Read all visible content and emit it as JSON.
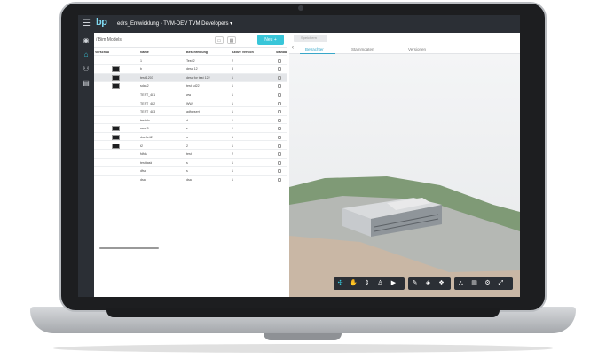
{
  "app": {
    "logo": "bp",
    "breadcrumb": "edrs_Entwicklung › TVM-DEV TVM Developers ▾"
  },
  "nav": {
    "menu_icon": "menu-icon",
    "items": [
      "eye-icon",
      "home-icon",
      "users-icon",
      "book-icon"
    ]
  },
  "list": {
    "title": "/ Bim Models",
    "new_button": "Neu",
    "columns": [
      "Vorschau",
      "Name",
      "Beschreibung",
      "Aktive Version",
      "Standa"
    ],
    "rows": [
      {
        "name": "1",
        "desc": "Test 2",
        "version": "2",
        "thumb": false,
        "selected": false
      },
      {
        "name": "b",
        "desc": "desc 12",
        "version": "3",
        "thumb": true,
        "selected": false
      },
      {
        "name": "test 1203",
        "desc": "desc for test 122",
        "version": "1",
        "thumb": true,
        "selected": true
      },
      {
        "name": "sdas2",
        "desc": "test sd22",
        "version": "1",
        "thumb": true,
        "selected": false
      },
      {
        "name": "TEST_4L1",
        "desc": "ww",
        "version": "1",
        "thumb": false,
        "selected": false
      },
      {
        "name": "TEST_4L2",
        "desc": "WW",
        "version": "1",
        "thumb": false,
        "selected": false
      },
      {
        "name": "TEST_4L3",
        "desc": "adfgvsert",
        "version": "1",
        "thumb": false,
        "selected": false
      },
      {
        "name": "test do",
        "desc": "d",
        "version": "1",
        "thumb": false,
        "selected": false
      },
      {
        "name": "new 5",
        "desc": "s",
        "version": "1",
        "thumb": true,
        "selected": false
      },
      {
        "name": "dse fe42",
        "desc": "s",
        "version": "1",
        "thumb": true,
        "selected": false
      },
      {
        "name": "t2",
        "desc": "2",
        "version": "1",
        "thumb": true,
        "selected": false
      },
      {
        "name": "fdfds",
        "desc": "test",
        "version": "2",
        "thumb": false,
        "selected": false
      },
      {
        "name": "test task",
        "desc": "s",
        "version": "1",
        "thumb": false,
        "selected": false
      },
      {
        "name": "dfsa",
        "desc": "s",
        "version": "1",
        "thumb": false,
        "selected": false
      },
      {
        "name": "dsa",
        "desc": "dsa",
        "version": "1",
        "thumb": false,
        "selected": false
      }
    ]
  },
  "viewer": {
    "save_button": "Speichern",
    "tabs": [
      "Betrachter",
      "Stammdaten",
      "Versionen"
    ],
    "active_tab": "Betrachter",
    "controls": [
      "orbit-icon",
      "pan-icon",
      "walk-icon",
      "person-icon",
      "camera-icon",
      "measure-icon",
      "section-icon",
      "explode-icon",
      "model-tree-icon",
      "properties-icon",
      "settings-icon",
      "fullscreen-icon"
    ]
  },
  "colors": {
    "accent": "#38c6d9",
    "topbar": "#2b2f35",
    "tab_active": "#38a7c9"
  }
}
